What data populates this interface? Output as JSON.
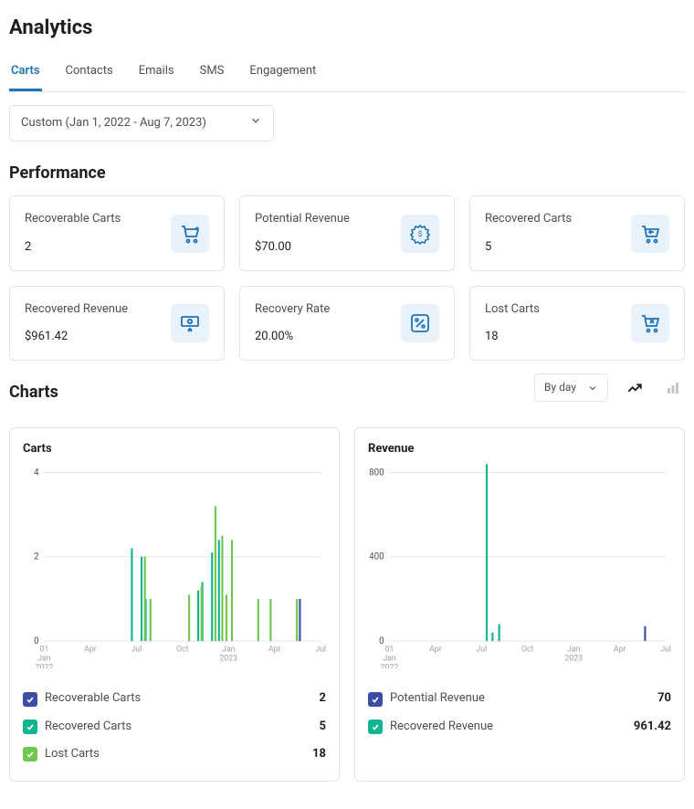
{
  "title": "Analytics",
  "tabs": [
    {
      "label": "Carts",
      "active": true
    },
    {
      "label": "Contacts"
    },
    {
      "label": "Emails"
    },
    {
      "label": "SMS"
    },
    {
      "label": "Engagement"
    }
  ],
  "date_range_select": "Custom (Jan 1, 2022 - Aug 7, 2023)",
  "performance": {
    "heading": "Performance",
    "cards": [
      {
        "label": "Recoverable Carts",
        "value": "2",
        "icon": "cart"
      },
      {
        "label": "Potential Revenue",
        "value": "$70.00",
        "icon": "badge-dollar"
      },
      {
        "label": "Recovered Carts",
        "value": "5",
        "icon": "cart-back"
      },
      {
        "label": "Recovered Revenue",
        "value": "$961.42",
        "icon": "cash-back"
      },
      {
        "label": "Recovery Rate",
        "value": "20.00%",
        "icon": "percent"
      },
      {
        "label": "Lost Carts",
        "value": "18",
        "icon": "cart-x"
      }
    ]
  },
  "charts": {
    "heading": "Charts",
    "granularity": "By day",
    "panels": {
      "carts": {
        "title": "Carts"
      },
      "revenue": {
        "title": "Revenue"
      }
    },
    "legend_carts": [
      {
        "color": "navy",
        "label": "Recoverable Carts",
        "value": "2"
      },
      {
        "color": "teal",
        "label": "Recovered Carts",
        "value": "5"
      },
      {
        "color": "lime",
        "label": "Lost Carts",
        "value": "18"
      }
    ],
    "legend_revenue": [
      {
        "color": "navy",
        "label": "Potential Revenue",
        "value": "70"
      },
      {
        "color": "teal",
        "label": "Recovered Revenue",
        "value": "961.42"
      }
    ]
  },
  "chart_data": [
    {
      "type": "bar",
      "title": "Carts",
      "xlabel": "",
      "ylabel": "",
      "ylim": [
        0,
        4
      ],
      "y_ticks": [
        0,
        2,
        4
      ],
      "x_ticks": [
        "01 Jan 2022",
        "Apr",
        "Jul",
        "Oct",
        "Jan 2023",
        "Apr",
        "Jul"
      ],
      "series": [
        {
          "name": "Recoverable Carts",
          "color": "#3b4ea6",
          "points": [
            {
              "t": 0.925,
              "v": 1
            }
          ]
        },
        {
          "name": "Recovered Carts",
          "color": "#13b490",
          "points": [
            {
              "t": 0.31,
              "v": 2.2
            },
            {
              "t": 0.345,
              "v": 2
            },
            {
              "t": 0.36,
              "v": 1
            },
            {
              "t": 0.55,
              "v": 1.2
            },
            {
              "t": 0.565,
              "v": 1.4
            },
            {
              "t": 0.6,
              "v": 2.1
            },
            {
              "t": 0.625,
              "v": 2.4
            }
          ]
        },
        {
          "name": "Lost Carts",
          "color": "#6fc74b",
          "points": [
            {
              "t": 0.35,
              "v": 2
            },
            {
              "t": 0.37,
              "v": 1
            },
            {
              "t": 0.51,
              "v": 1.1
            },
            {
              "t": 0.555,
              "v": 1.3
            },
            {
              "t": 0.605,
              "v": 3.2
            },
            {
              "t": 0.63,
              "v": 2.5
            },
            {
              "t": 0.645,
              "v": 1.1
            },
            {
              "t": 0.665,
              "v": 2.4
            },
            {
              "t": 0.76,
              "v": 1
            },
            {
              "t": 0.805,
              "v": 1
            },
            {
              "t": 0.9,
              "v": 1
            }
          ]
        }
      ]
    },
    {
      "type": "bar",
      "title": "Revenue",
      "xlabel": "",
      "ylabel": "",
      "ylim": [
        0,
        800
      ],
      "y_ticks": [
        0,
        400,
        800
      ],
      "x_ticks": [
        "01 Jan 2022",
        "Apr",
        "Jul",
        "Oct",
        "Jan 2023",
        "Apr",
        "Jul"
      ],
      "series": [
        {
          "name": "Potential Revenue",
          "color": "#3b4ea6",
          "points": [
            {
              "t": 0.925,
              "v": 70
            }
          ]
        },
        {
          "name": "Recovered Revenue",
          "color": "#13b490",
          "points": [
            {
              "t": 0.345,
              "v": 840
            },
            {
              "t": 0.366,
              "v": 40
            },
            {
              "t": 0.39,
              "v": 80
            }
          ]
        }
      ]
    }
  ]
}
